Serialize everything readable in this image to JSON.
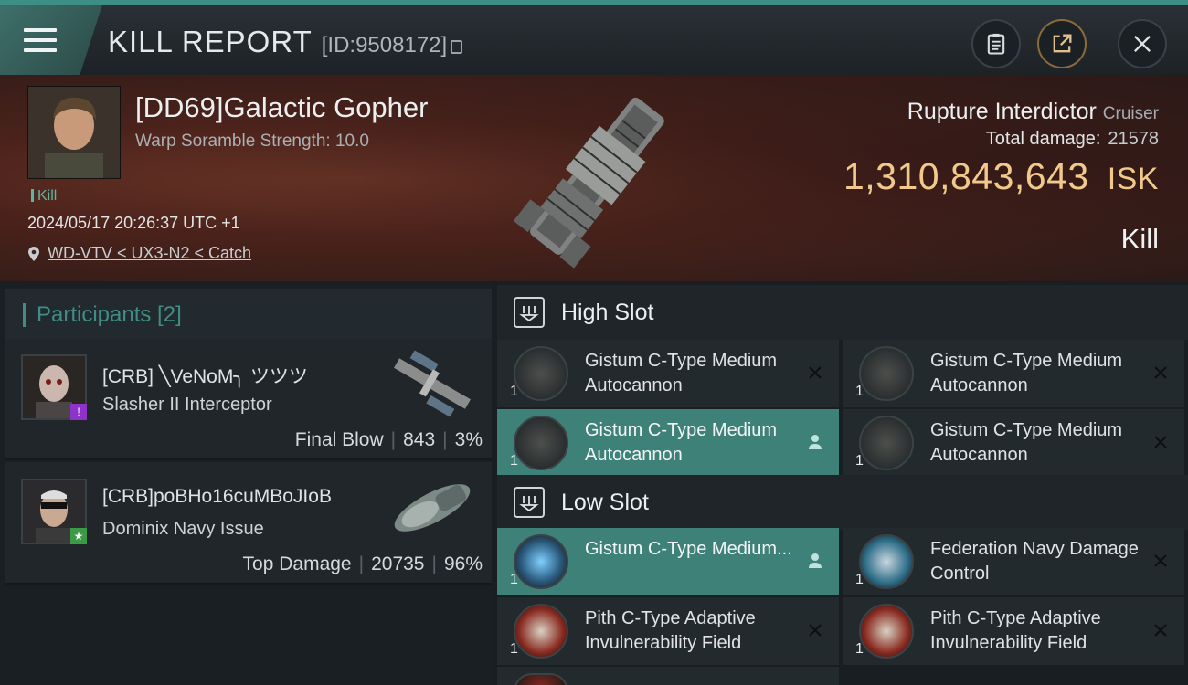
{
  "header": {
    "title": "KILL REPORT",
    "report_id": "[ID:9508172]",
    "menu_icon": "hamburger-menu-icon",
    "buttons": [
      "clipboard-icon",
      "share-icon",
      "close-icon"
    ]
  },
  "victim": {
    "name": "[DD69]Galactic Gopher",
    "scramble": "Warp Soramble Strength: 10.0",
    "tag": "Kill",
    "datetime": "2024/05/17 20:26:37 UTC +1",
    "location": "WD-VTV < UX3-N2 < Catch",
    "ship_name": "Rupture Interdictor",
    "ship_class": "Cruiser",
    "total_damage_label": "Total damage:",
    "total_damage": "21578",
    "isk_value": "1,310,843,643",
    "isk_unit": "ISK",
    "result": "Kill"
  },
  "participants": {
    "heading": "Participants [2]",
    "list": [
      {
        "name": "[CRB] ╲VeNoM╮ ツツツ",
        "ship": "Slasher II Interceptor",
        "role": "Final Blow",
        "damage": "843",
        "percent": "3%",
        "badge_color": "#8e33c9",
        "badge_icon": "bolt-icon"
      },
      {
        "name": "[CRB]poBHo16cuMBoJIoB",
        "ship": "Dominix Navy Issue",
        "role": "Top Damage",
        "damage": "20735",
        "percent": "96%",
        "badge_color": "#3b9a45",
        "badge_icon": "star-icon"
      }
    ]
  },
  "fitting": {
    "high_slot_label": "High Slot",
    "low_slot_label": "Low Slot",
    "high_slot": [
      {
        "name": "Gistum C-Type Medium Autocannon",
        "qty": "1",
        "status": "destroyed"
      },
      {
        "name": "Gistum C-Type Medium Autocannon",
        "qty": "1",
        "status": "destroyed"
      },
      {
        "name": "Gistum C-Type Medium Autocannon",
        "qty": "1",
        "status": "dropped"
      },
      {
        "name": "Gistum C-Type Medium Autocannon",
        "qty": "1",
        "status": "destroyed"
      }
    ],
    "low_slot": [
      {
        "name": "Gistum C-Type Medium...",
        "qty": "1",
        "status": "dropped"
      },
      {
        "name": "Federation Navy Damage Control",
        "qty": "1",
        "status": "destroyed"
      },
      {
        "name": "Pith C-Type Adaptive Invulnerability Field",
        "qty": "1",
        "status": "destroyed"
      },
      {
        "name": "Pith C-Type Adaptive Invulnerability Field",
        "qty": "1",
        "status": "destroyed"
      }
    ]
  },
  "colors": {
    "accent": "#3e8178",
    "isk": "#f1c98a",
    "teal_text": "#3f8d84"
  }
}
